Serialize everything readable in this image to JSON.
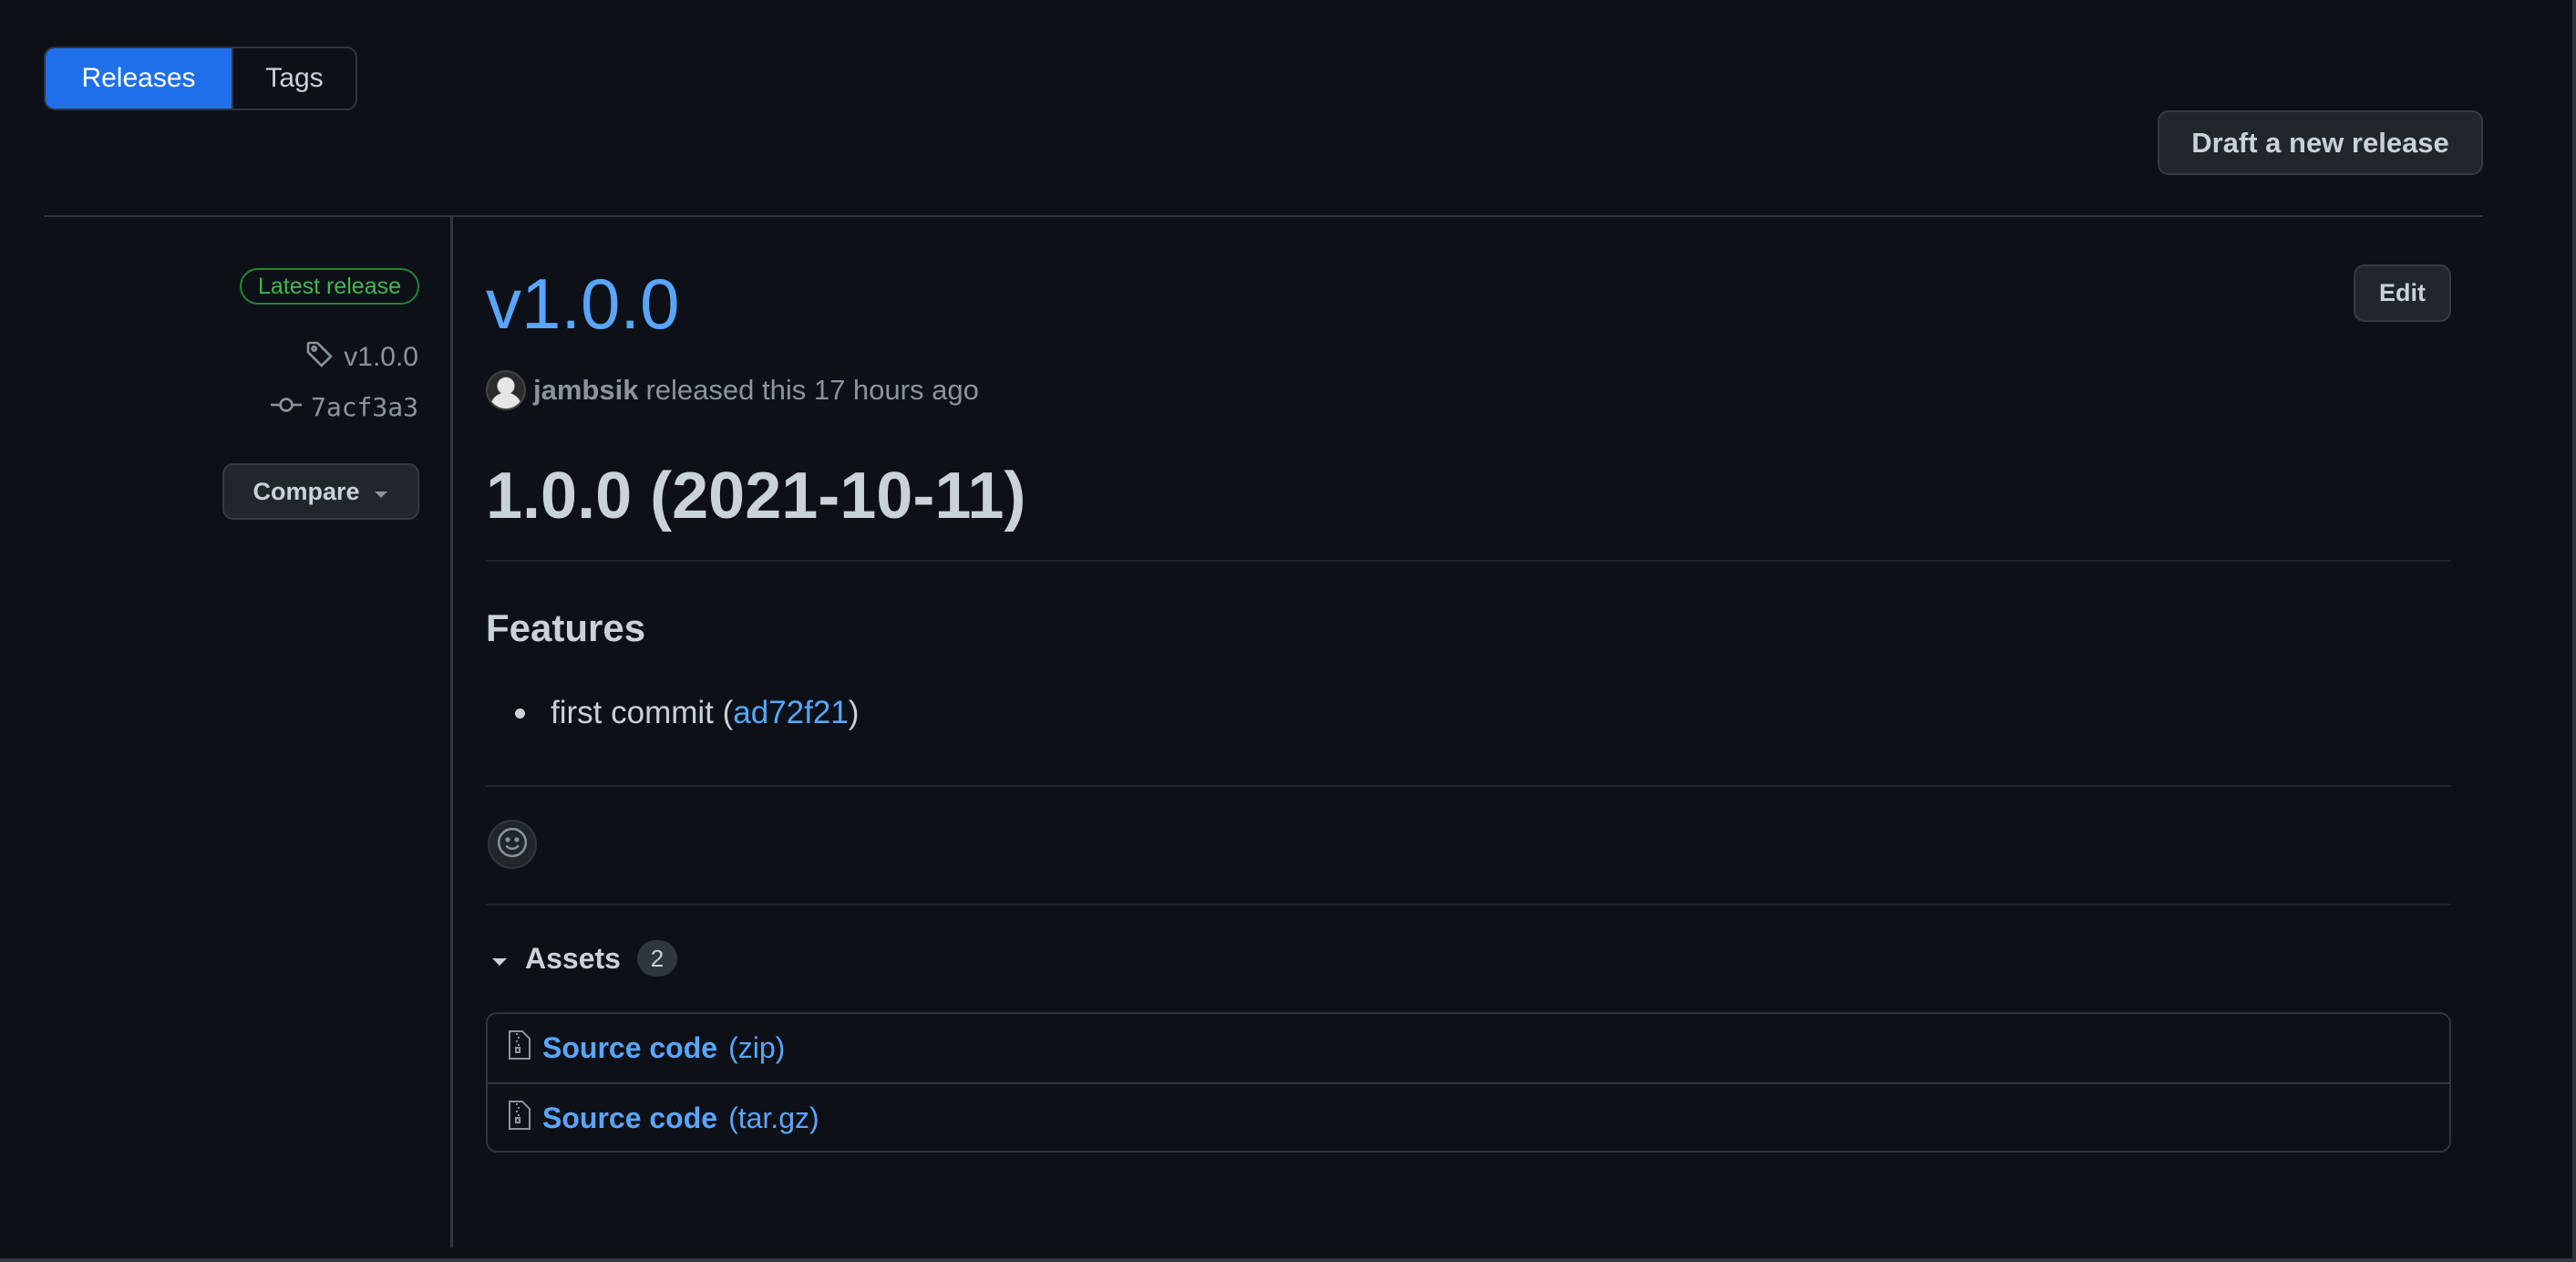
{
  "tabs": [
    {
      "label": "Releases",
      "active": true
    },
    {
      "label": "Tags",
      "active": false
    }
  ],
  "header": {
    "draft_label": "Draft a new release"
  },
  "sidebar": {
    "badge": "Latest release",
    "tag": "v1.0.0",
    "commit": "7acf3a3",
    "compare_label": "Compare"
  },
  "release": {
    "title": "v1.0.0",
    "edit_label": "Edit",
    "author": "jambsik",
    "released_text": "released this 17 hours ago",
    "heading": "1.0.0 (2021-10-11)",
    "section": "Features",
    "item_text": "first commit (",
    "item_link": "ad72f21",
    "item_close": ")"
  },
  "assets": {
    "label": "Assets",
    "count": "2",
    "items": [
      {
        "name": "Source code",
        "ext": "(zip)"
      },
      {
        "name": "Source code",
        "ext": "(tar.gz)"
      }
    ]
  },
  "colors": {
    "background": "#0d1117",
    "accent": "#1f6feb",
    "link": "#58a6ff",
    "success": "#3fb950"
  },
  "icons": [
    "tag-icon",
    "git-commit-icon",
    "triangle-down-icon",
    "smiley-icon",
    "file-zip-icon"
  ]
}
